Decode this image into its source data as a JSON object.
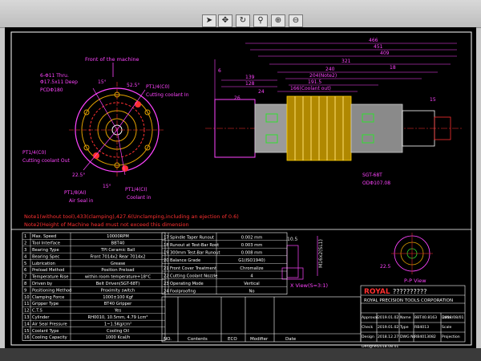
{
  "drawing": {
    "front_label": "Front of the machine",
    "holes_label": "6-Φ11 Thru.",
    "holes_label2": "Φ17.5x11 Deep",
    "pcd_label": "PCDΦ180",
    "angle_15": "15°",
    "angle_52": "52.5°",
    "angle_22": "22.5°",
    "angle_15b": "15°",
    "pt_cutting_out_top": "PT1/4(C0)",
    "cutting_out_top": "Cutting coolant In",
    "pt_cutting_left": "PT1/4(C0)",
    "cutting_left": "Cutting coolant Out",
    "pt_air_in": "PT1/8(AI)",
    "air_in": "Air Seal in",
    "pt_coolant_in": "PT1/4(CI)",
    "coolant_in": "Coolant in",
    "dims_top": [
      "466",
      "451",
      "409",
      "321",
      "240",
      "204(Note2)",
      "191.5",
      "166(Coolant out)",
      "139",
      "128",
      "26",
      "18",
      "6",
      "24",
      "15"
    ],
    "sgt_label": "SGT-68T",
    "od_label": "ODΦ107.08",
    "view_x": "X View(S=3:1)",
    "view_p": "P-P View",
    "note1": "Note1(without tool),433(clamping),427.6(Unclamping,including an ejection of 0.6)",
    "note2": "Note2(Height of Machine head must not exceed this dimension",
    "dim_105": "10.5",
    "dim_m16": "M16x2(SL1)",
    "dim_225": "22.5"
  },
  "spec_rows": [
    {
      "n": "1",
      "label": "Max. Speed",
      "value": "10000RPM"
    },
    {
      "n": "2",
      "label": "Tool Interface",
      "value": "BBT40"
    },
    {
      "n": "3",
      "label": "Bearing Type",
      "value": "TPI Ceramic Ball"
    },
    {
      "n": "4",
      "label": "Bearing Spec",
      "value": "Front 7014x2 Rear 7014x2"
    },
    {
      "n": "5",
      "label": "Lubrication",
      "value": "Grease"
    },
    {
      "n": "6",
      "label": "Preload Method",
      "value": "Position Preload"
    },
    {
      "n": "7",
      "label": "Temperature Rise",
      "value": "within room temperature+18°C"
    },
    {
      "n": "8",
      "label": "Driven by",
      "value": "Belt Driven(SGT-68T)"
    },
    {
      "n": "9",
      "label": "Positioning Method",
      "value": "Proximity switch"
    },
    {
      "n": "10",
      "label": "Clamping Force",
      "value": "1000±100 Kgf"
    },
    {
      "n": "11",
      "label": "Gripper Type",
      "value": "BT40 Gripper"
    },
    {
      "n": "12",
      "label": "C.T.S",
      "value": "Yes"
    },
    {
      "n": "13",
      "label": "Cylinder",
      "value": "RH0010, 10.5mm, 4.79 Lcm²"
    },
    {
      "n": "14",
      "label": "Air Seal Pressure",
      "value": "1~1.5Kg/cm²"
    },
    {
      "n": "15",
      "label": "Coolant Type",
      "value": "Cooling Oil"
    },
    {
      "n": "16",
      "label": "Cooling Capacity",
      "value": "1000 Kcal/h"
    }
  ],
  "spec_rows2": [
    {
      "n": "17",
      "label": "Spindle Taper Runout",
      "value": "0.002 mm"
    },
    {
      "n": "18",
      "label": "Runout at Test-Bar Root",
      "value": "0.003 mm"
    },
    {
      "n": "19",
      "label": "300mm Test-Bar Runout",
      "value": "0.008 mm"
    },
    {
      "n": "20",
      "label": "Balance Grade",
      "value": "G1(ISO1940)"
    },
    {
      "n": "21",
      "label": "Front Cover Treatment",
      "value": "Chromalize"
    },
    {
      "n": "22",
      "label": "Cutting Coolant Nozzle",
      "value": "4"
    },
    {
      "n": "23",
      "label": "Operating Mode",
      "value": "Vertical"
    },
    {
      "n": "24",
      "label": "Foolproofing",
      "value": "No"
    }
  ],
  "title_block": {
    "brand": "ROYAL",
    "company": "ROYAL PRECISION TOOLS CORPORATION",
    "question": "??????????",
    "rows": [
      {
        "role": "Approval",
        "date": "2019.01.02",
        "k1": "Name",
        "v1": "BBT40.8163",
        "k2": "Date",
        "v2": "2018/08/01"
      },
      {
        "role": "Check",
        "date": "2019.01.02",
        "k1": "Type",
        "v1": "RB4013",
        "k2": "Scale",
        "v2": ""
      },
      {
        "role": "Design",
        "date": "2018.12.27",
        "k1": "DWG No",
        "v1": "RB4013082",
        "k2": "Projection",
        "v2": ""
      },
      {
        "role": "Designer",
        "date": "2018.08.01",
        "k1": "",
        "v1": "",
        "k2": "",
        "v2": ""
      }
    ],
    "rev_headers": [
      "NO.",
      "Contents",
      "ECO",
      "Modifier",
      "Date"
    ]
  },
  "colors": {
    "screen": "#000000",
    "frame": "#ffffff",
    "annot": "#ff44ff",
    "body": "#c8b400",
    "label": "#ff3030",
    "cyan": "#33d6ff",
    "green": "#30e030",
    "dim": "#e0e0e0"
  }
}
